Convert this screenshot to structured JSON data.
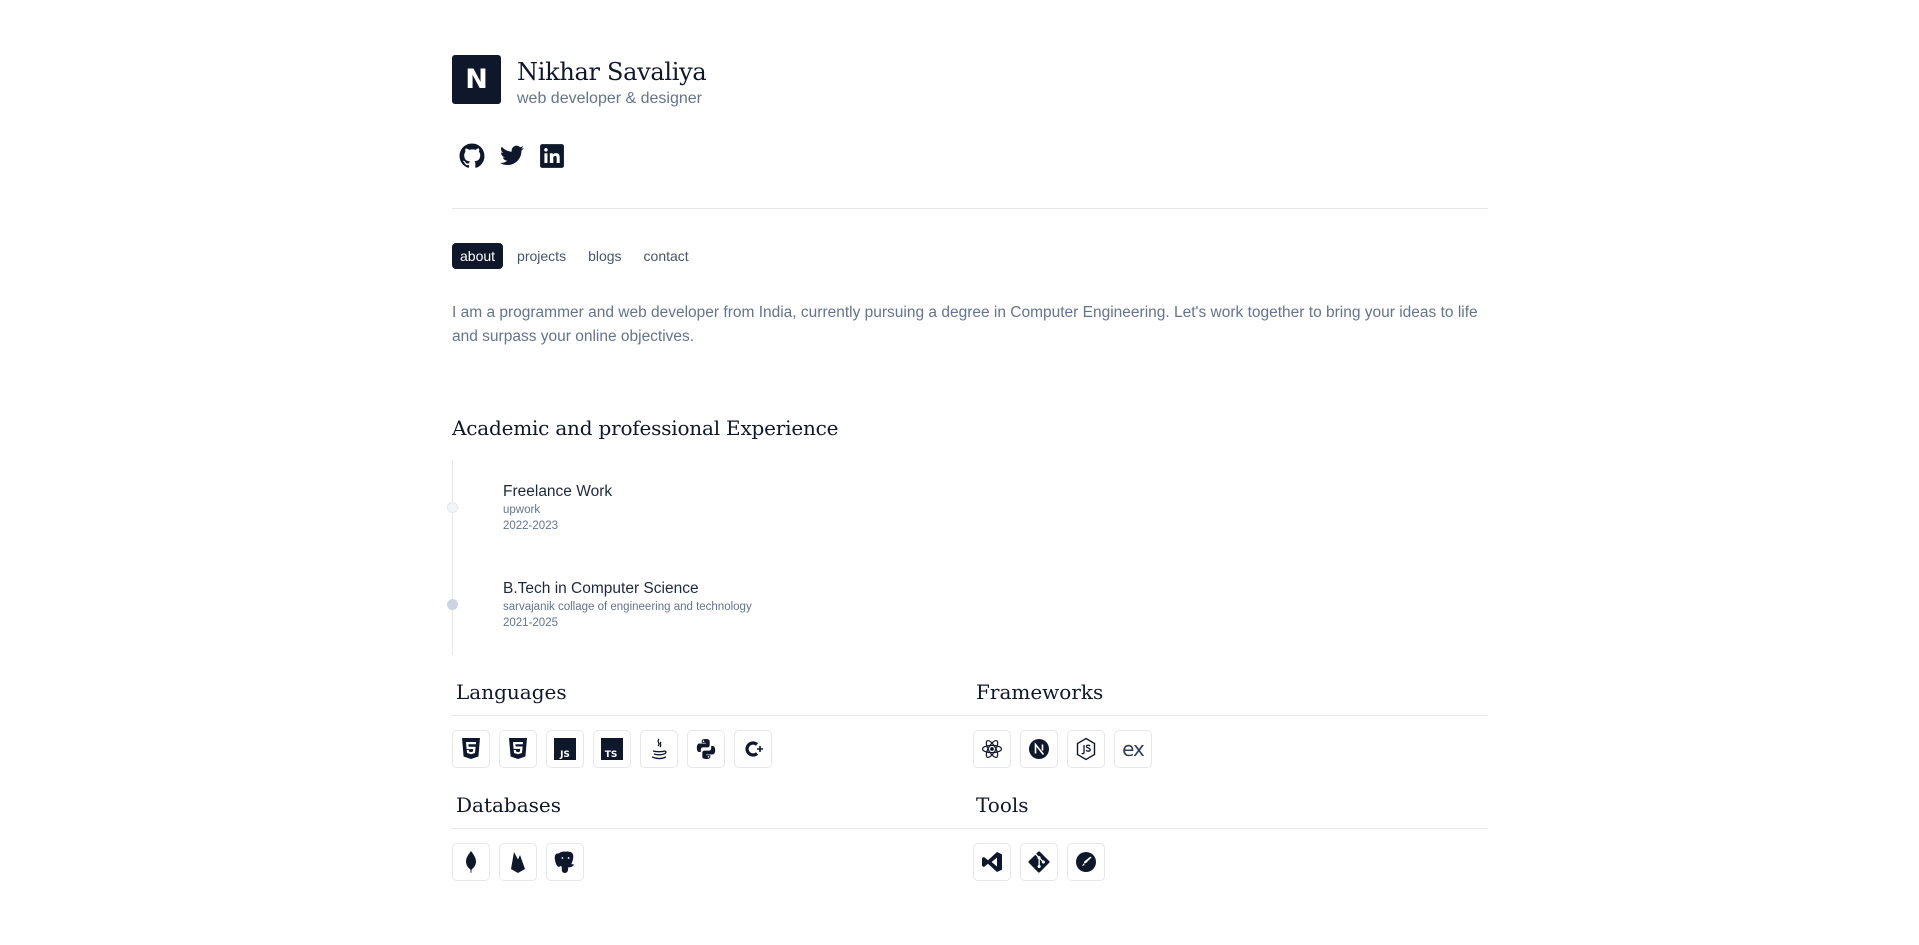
{
  "profile": {
    "logo_letter": "N",
    "name": "Nikhar Savaliya",
    "tagline": "web developer & designer"
  },
  "socials": [
    {
      "icon": "github-icon"
    },
    {
      "icon": "twitter-icon"
    },
    {
      "icon": "linkedin-icon"
    }
  ],
  "nav": {
    "items": [
      "about",
      "projects",
      "blogs",
      "contact"
    ],
    "active": "about"
  },
  "bio": "I am a programmer and web developer from India, currently pursuing a degree in Computer Engineering. Let's work together to bring your ideas to life and surpass your online objectives.",
  "experience": {
    "heading": "Academic and professional Experience",
    "items": [
      {
        "title": "Freelance Work",
        "org": "upwork",
        "years": "2022-2023"
      },
      {
        "title": "B.Tech in Computer Science",
        "org": "sarvajanik collage of engineering and technology",
        "years": "2021-2025"
      }
    ]
  },
  "skills": {
    "languages": {
      "heading": "Languages",
      "icons": [
        "html5-icon",
        "css3-icon",
        "javascript-icon",
        "typescript-icon",
        "java-icon",
        "python-icon",
        "cplusplus-icon"
      ]
    },
    "frameworks": {
      "heading": "Frameworks",
      "icons": [
        "react-icon",
        "nextjs-icon",
        "nodejs-icon",
        "express-icon"
      ]
    },
    "databases": {
      "heading": "Databases",
      "icons": [
        "mongodb-icon",
        "firebase-icon",
        "postgresql-icon"
      ]
    },
    "tools": {
      "heading": "Tools",
      "icons": [
        "vscode-icon",
        "git-icon",
        "postman-icon"
      ]
    }
  },
  "icon_glyphs": {
    "javascript": "JS",
    "typescript": "TS",
    "express": "ex"
  },
  "colors": {
    "primary": "#0f172a",
    "muted": "#64748b",
    "border": "#e5e7eb"
  }
}
